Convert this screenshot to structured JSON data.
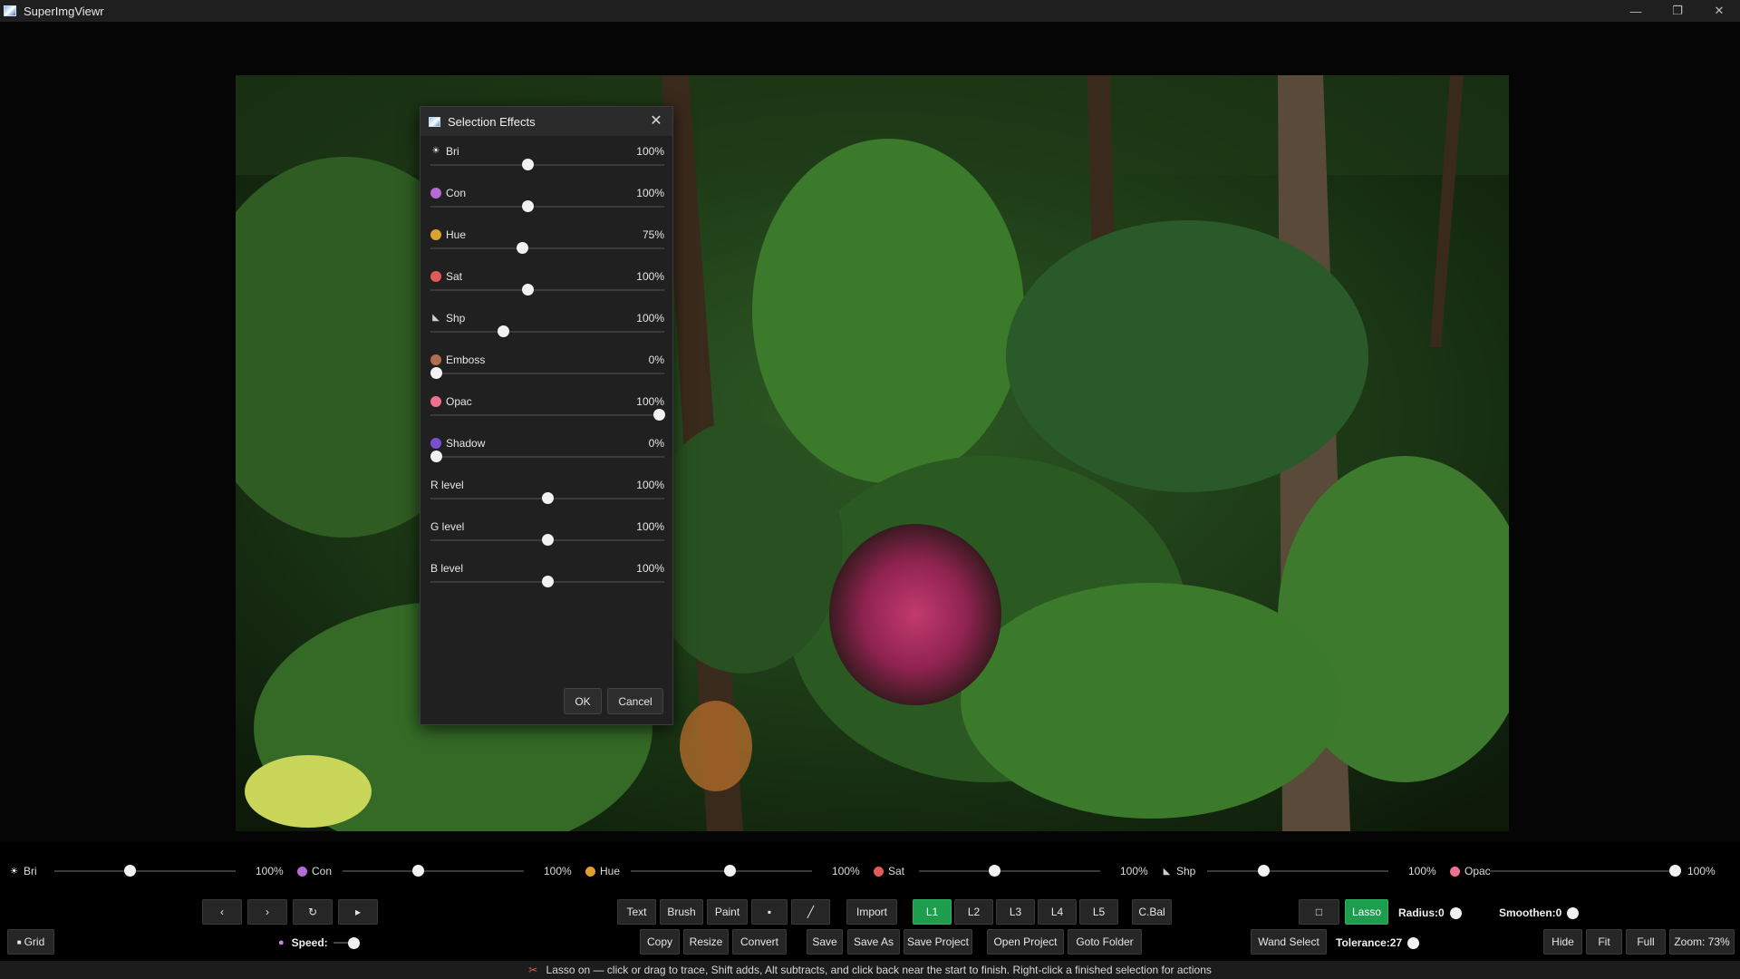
{
  "window": {
    "title": "SuperImgViewr",
    "controls": [
      "—",
      "❐",
      "✕"
    ]
  },
  "dialog": {
    "title": "Selection Effects",
    "close": "✕",
    "rows": [
      {
        "name": "bri",
        "icon": "sun-icon",
        "glyph": "☀",
        "color": "#ffffff",
        "label": "Bri",
        "value": "100%",
        "level": 0.41
      },
      {
        "name": "con",
        "icon": "contrast-icon",
        "glyph": "",
        "color": "#b46bd6",
        "label": "Con",
        "value": "100%",
        "level": 0.41
      },
      {
        "name": "hue",
        "icon": "rainbow-icon",
        "glyph": "",
        "color": "#e0a030",
        "label": "Hue",
        "value": "75%",
        "level": 0.385
      },
      {
        "name": "sat",
        "icon": "palette-icon",
        "glyph": "",
        "color": "#e05a5a",
        "label": "Sat",
        "value": "100%",
        "level": 0.41
      },
      {
        "name": "shp",
        "icon": "triangle-ruler-icon",
        "glyph": "◣",
        "color": "#cfcfcf",
        "label": "Shp",
        "value": "100%",
        "level": 0.3
      },
      {
        "name": "emboss",
        "icon": "emboss-icon",
        "glyph": "",
        "color": "#b07050",
        "label": "Emboss",
        "value": "0%",
        "level": 0.0
      },
      {
        "name": "opac",
        "icon": "ghost-icon",
        "glyph": "",
        "color": "#f07090",
        "label": "Opac",
        "value": "100%",
        "level": 1.0
      },
      {
        "name": "shadow",
        "icon": "shadow-orb-icon",
        "glyph": "",
        "color": "#7a4ed0",
        "label": "Shadow",
        "value": "0%",
        "level": 0.0
      },
      {
        "name": "r-level",
        "icon": "",
        "glyph": "",
        "color": "",
        "label": "R level",
        "value": "100%",
        "level": 0.5
      },
      {
        "name": "g-level",
        "icon": "",
        "glyph": "",
        "color": "",
        "label": "G level",
        "value": "100%",
        "level": 0.5
      },
      {
        "name": "b-level",
        "icon": "",
        "glyph": "",
        "color": "",
        "label": "B level",
        "value": "100%",
        "level": 0.5
      }
    ],
    "ok": "OK",
    "cancel": "Cancel"
  },
  "bottom_sliders": [
    {
      "name": "bri",
      "icon": "sun-icon",
      "glyph": "☀",
      "color": "#ffffff",
      "label": "Bri",
      "value": "100%",
      "level": 0.41
    },
    {
      "name": "con",
      "icon": "contrast-icon",
      "glyph": "",
      "color": "#b46bd6",
      "label": "Con",
      "value": "100%",
      "level": 0.41
    },
    {
      "name": "hue",
      "icon": "rainbow-icon",
      "glyph": "",
      "color": "#e0a030",
      "label": "Hue",
      "value": "100%",
      "level": 0.55
    },
    {
      "name": "sat",
      "icon": "palette-icon",
      "glyph": "",
      "color": "#e05a5a",
      "label": "Sat",
      "value": "100%",
      "level": 0.41
    },
    {
      "name": "shp",
      "icon": "triangle-ruler-icon",
      "glyph": "◣",
      "color": "#cfcfcf",
      "label": "Shp",
      "value": "100%",
      "level": 0.3
    },
    {
      "name": "opac",
      "icon": "ghost-icon",
      "glyph": "",
      "color": "#f07090",
      "label": "Opac",
      "value": "100%",
      "level": 1.0
    }
  ],
  "toolbar1": {
    "nav": [
      "‹",
      "›",
      "↻",
      "▸"
    ],
    "tools": [
      "Text",
      "Brush",
      "Paint",
      "▪",
      "╱"
    ],
    "import": "Import",
    "layers": [
      "L1",
      "L2",
      "L3",
      "L4",
      "L5"
    ],
    "active_layer": "L1",
    "cbal": "C.Bal",
    "rect": "□",
    "lasso": "Lasso",
    "radius": "Radius:0",
    "smoothen": "Smoothen:0"
  },
  "toolbar2": {
    "grid": "Grid",
    "speed": "Speed:",
    "edit": [
      "Copy",
      "Resize",
      "Convert"
    ],
    "file": [
      "Save",
      "Save As",
      "Save Project"
    ],
    "folder": [
      "Open Project",
      "Goto Folder"
    ],
    "wand": "Wand Select",
    "tolerance": "Tolerance:27",
    "view": [
      "Hide",
      "Fit",
      "Full"
    ],
    "zoom": "Zoom: 73%"
  },
  "status": {
    "icon": "✂",
    "text": "Lasso on — click or drag to trace, Shift adds, Alt subtracts, and click back near the start to finish. Right-click a finished selection for actions"
  },
  "colors": {
    "accent_green": "#1f9d4f",
    "bg": "#000000",
    "panel": "#202020"
  }
}
